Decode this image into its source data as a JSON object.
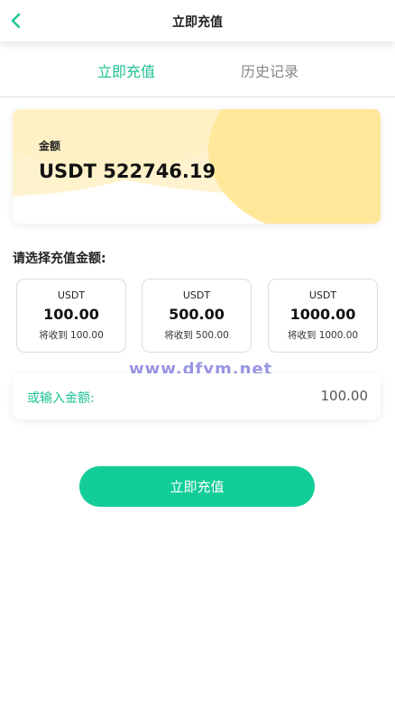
{
  "header": {
    "title": "立即充值",
    "back_icon": "chevron-left-icon"
  },
  "tabs": [
    {
      "label": "立即充值",
      "active": true
    },
    {
      "label": "历史记录",
      "active": false
    }
  ],
  "balance": {
    "label": "金额",
    "value": "USDT 522746.19"
  },
  "options_section": {
    "label": "请选择充值金额:"
  },
  "options": [
    {
      "currency": "USDT",
      "amount": "100.00",
      "receive": "将收到 100.00"
    },
    {
      "currency": "USDT",
      "amount": "500.00",
      "receive": "将收到 500.00"
    },
    {
      "currency": "USDT",
      "amount": "1000.00",
      "receive": "将收到 1000.00"
    }
  ],
  "custom_amount": {
    "label": "或输入金额:",
    "value": "100.00"
  },
  "submit": {
    "label": "立即充值"
  },
  "watermark": "www.dfym.net",
  "colors": {
    "accent": "#1cc192",
    "button": "#12cd97",
    "card_gradient": "#ffe89a"
  }
}
